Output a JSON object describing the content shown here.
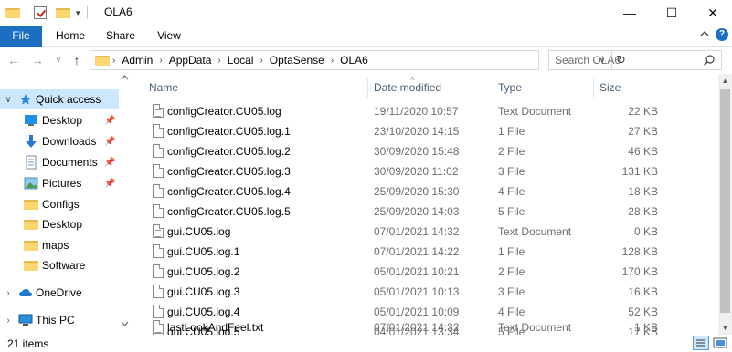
{
  "window": {
    "title": "OLA6",
    "minimize": "—",
    "maximize": "☐",
    "close": "✕"
  },
  "ribbon": {
    "tabs": [
      "File",
      "Home",
      "Share",
      "View"
    ],
    "collapse_icon": "chevron-up-icon",
    "help_icon": "?"
  },
  "nav": {
    "back": "←",
    "forward": "→",
    "recent": "∨",
    "up": "↑"
  },
  "address": {
    "crumbs": [
      "Admin",
      "AppData",
      "Local",
      "OptaSense",
      "OLA6"
    ],
    "separator": "›"
  },
  "search": {
    "placeholder": "Search OLA6"
  },
  "navpane": {
    "items": [
      {
        "label": "Quick access",
        "icon": "star-icon",
        "expander": "∨",
        "selected": true,
        "pinned": false
      },
      {
        "label": "Desktop",
        "icon": "desktop-icon",
        "pinned": true
      },
      {
        "label": "Downloads",
        "icon": "download-icon",
        "pinned": true
      },
      {
        "label": "Documents",
        "icon": "documents-icon",
        "pinned": true
      },
      {
        "label": "Pictures",
        "icon": "pictures-icon",
        "pinned": true
      },
      {
        "label": "Configs",
        "icon": "folder-icon",
        "pinned": false
      },
      {
        "label": "Desktop",
        "icon": "folder-icon",
        "pinned": false
      },
      {
        "label": "maps",
        "icon": "folder-icon",
        "pinned": false
      },
      {
        "label": "Software",
        "icon": "folder-icon",
        "pinned": false
      },
      {
        "label": "OneDrive",
        "icon": "cloud-icon",
        "expander": "›"
      },
      {
        "label": "This PC",
        "icon": "pc-icon",
        "expander": "›"
      }
    ]
  },
  "columns": {
    "name": "Name",
    "date": "Date modified",
    "type": "Type",
    "size": "Size"
  },
  "files": [
    {
      "name": "configCreator.CU05.log",
      "date": "19/11/2020 10:57",
      "type": "Text Document",
      "size": "22 KB",
      "icon": "text-file-icon"
    },
    {
      "name": "configCreator.CU05.log.1",
      "date": "23/10/2020 14:15",
      "type": "1 File",
      "size": "27 KB",
      "icon": "file-icon"
    },
    {
      "name": "configCreator.CU05.log.2",
      "date": "30/09/2020 15:48",
      "type": "2 File",
      "size": "46 KB",
      "icon": "file-icon"
    },
    {
      "name": "configCreator.CU05.log.3",
      "date": "30/09/2020 11:02",
      "type": "3 File",
      "size": "131 KB",
      "icon": "file-icon"
    },
    {
      "name": "configCreator.CU05.log.4",
      "date": "25/09/2020 15:30",
      "type": "4 File",
      "size": "18 KB",
      "icon": "file-icon"
    },
    {
      "name": "configCreator.CU05.log.5",
      "date": "25/09/2020 14:03",
      "type": "5 File",
      "size": "28 KB",
      "icon": "file-icon"
    },
    {
      "name": "gui.CU05.log",
      "date": "07/01/2021 14:32",
      "type": "Text Document",
      "size": "0 KB",
      "icon": "text-file-icon"
    },
    {
      "name": "gui.CU05.log.1",
      "date": "07/01/2021 14:22",
      "type": "1 File",
      "size": "128 KB",
      "icon": "file-icon"
    },
    {
      "name": "gui.CU05.log.2",
      "date": "05/01/2021 10:21",
      "type": "2 File",
      "size": "170 KB",
      "icon": "file-icon"
    },
    {
      "name": "gui.CU05.log.3",
      "date": "05/01/2021 10:13",
      "type": "3 File",
      "size": "16 KB",
      "icon": "file-icon"
    },
    {
      "name": "gui.CU05.log.4",
      "date": "05/01/2021 10:09",
      "type": "4 File",
      "size": "52 KB",
      "icon": "file-icon"
    },
    {
      "name": "gui.CU05.log.5",
      "date": "04/01/2021 13:34",
      "type": "5 File",
      "size": "17 KB",
      "icon": "file-icon"
    },
    {
      "name": "lastLookAndFeel.txt",
      "date": "07/01/2021 14:32",
      "type": "Text Document",
      "size": "1 KB",
      "icon": "text-file-icon"
    }
  ],
  "status": {
    "item_count": "21 items"
  },
  "colors": {
    "accent": "#1a6fc0",
    "selection": "#cce8ff",
    "folder": "#fcd670"
  }
}
